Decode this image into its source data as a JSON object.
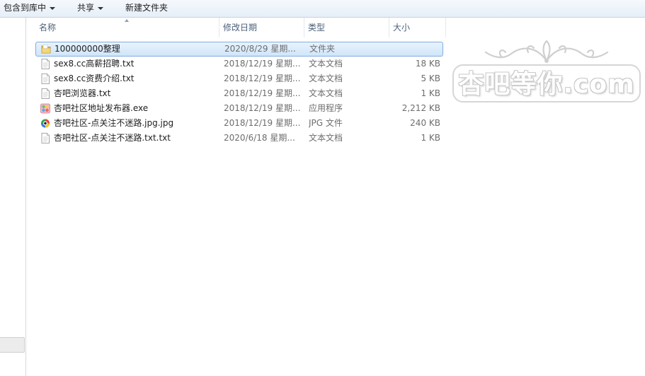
{
  "toolbar": {
    "include_library": "包含到库中",
    "share": "共享",
    "new_folder": "新建文件夹"
  },
  "columns": {
    "name": "名称",
    "date": "修改日期",
    "type": "类型",
    "size": "大小"
  },
  "files": [
    {
      "name": "100000000整理",
      "date": "2020/8/29 星期...",
      "type": "文件夹",
      "size": "",
      "icon": "folder-icon",
      "selected": true
    },
    {
      "name": "sex8.cc高薪招聘.txt",
      "date": "2018/12/19 星期...",
      "type": "文本文档",
      "size": "18 KB",
      "icon": "text-file-icon"
    },
    {
      "name": "sex8.cc资费介绍.txt",
      "date": "2018/12/19 星期...",
      "type": "文本文档",
      "size": "5 KB",
      "icon": "text-file-icon"
    },
    {
      "name": "杏吧浏览器.txt",
      "date": "2018/12/19 星期...",
      "type": "文本文档",
      "size": "1 KB",
      "icon": "text-file-icon"
    },
    {
      "name": "杏吧社区地址发布器.exe",
      "date": "2018/12/19 星期...",
      "type": "应用程序",
      "size": "2,212 KB",
      "icon": "application-icon"
    },
    {
      "name": "杏吧社区-点关注不迷路.jpg.jpg",
      "date": "2018/12/19 星期...",
      "type": "JPG 文件",
      "size": "240 KB",
      "icon": "image-file-icon"
    },
    {
      "name": "杏吧社区-点关注不迷路.txt.txt",
      "date": "2020/6/18 星期...",
      "type": "文本文档",
      "size": "1 KB",
      "icon": "text-file-icon"
    }
  ],
  "watermark": {
    "text": "杏吧等你.com"
  },
  "colors": {
    "selection_fill": "#cfe6fa",
    "selection_border": "#84acdd",
    "header_text": "#4c607a",
    "secondary_text": "#6d6d6d"
  }
}
